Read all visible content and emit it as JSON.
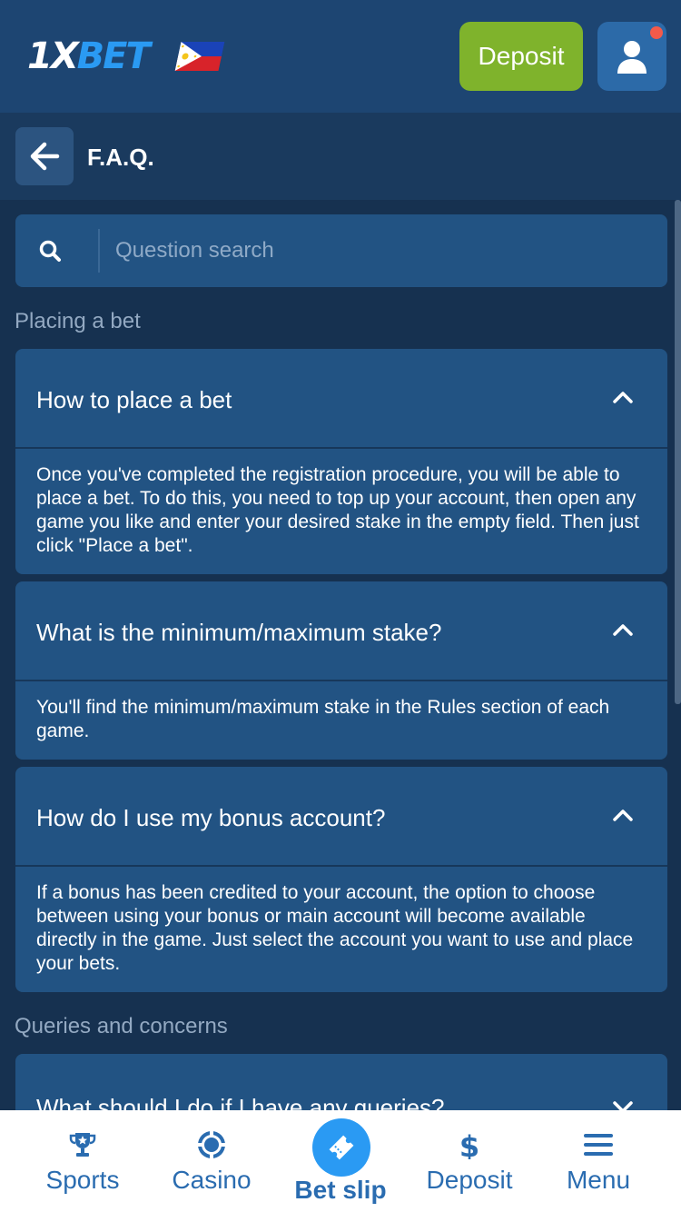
{
  "header": {
    "logo_prefix": "1X",
    "logo_suffix": "BET",
    "deposit_label": "Deposit",
    "flag_icon": "philippines-flag-icon",
    "profile_icon": "user-icon"
  },
  "titlebar": {
    "title": "F.A.Q.",
    "back_icon": "arrow-left-icon"
  },
  "search": {
    "placeholder": "Question search",
    "value": ""
  },
  "sections": [
    {
      "label": "Placing a bet",
      "items": [
        {
          "question": "How to place a bet",
          "answer": "Once you've completed the registration procedure, you will be able to place a bet. To do this, you need to top up your account, then open any game you like and enter your desired stake in the empty field. Then just click \"Place a bet\".",
          "expanded": true
        },
        {
          "question": "What is the minimum/maximum stake?",
          "answer": "You'll find the minimum/maximum stake in the Rules section of each game.",
          "expanded": true
        },
        {
          "question": "How do I use my bonus account?",
          "answer": "If a bonus has been credited to your account, the option to choose between using your bonus or main account will become available directly in the game. Just select the account you want to use and place your bets.",
          "expanded": true
        }
      ]
    },
    {
      "label": "Queries and concerns",
      "items": [
        {
          "question": "What should I do if I have any queries?",
          "expanded": false
        }
      ]
    }
  ],
  "bottom_nav": [
    {
      "label": "Sports",
      "icon": "trophy-icon"
    },
    {
      "label": "Casino",
      "icon": "casino-chip-icon"
    },
    {
      "label": "Bet slip",
      "icon": "ticket-icon",
      "active": true
    },
    {
      "label": "Deposit",
      "icon": "dollar-icon"
    },
    {
      "label": "Menu",
      "icon": "hamburger-menu-icon"
    }
  ],
  "colors": {
    "background": "#163150",
    "header": "#1d4572",
    "card": "#225383",
    "deposit_button": "#7fb32c",
    "accent_blue": "#2a9af3",
    "nav_text": "#2a6cb0"
  }
}
